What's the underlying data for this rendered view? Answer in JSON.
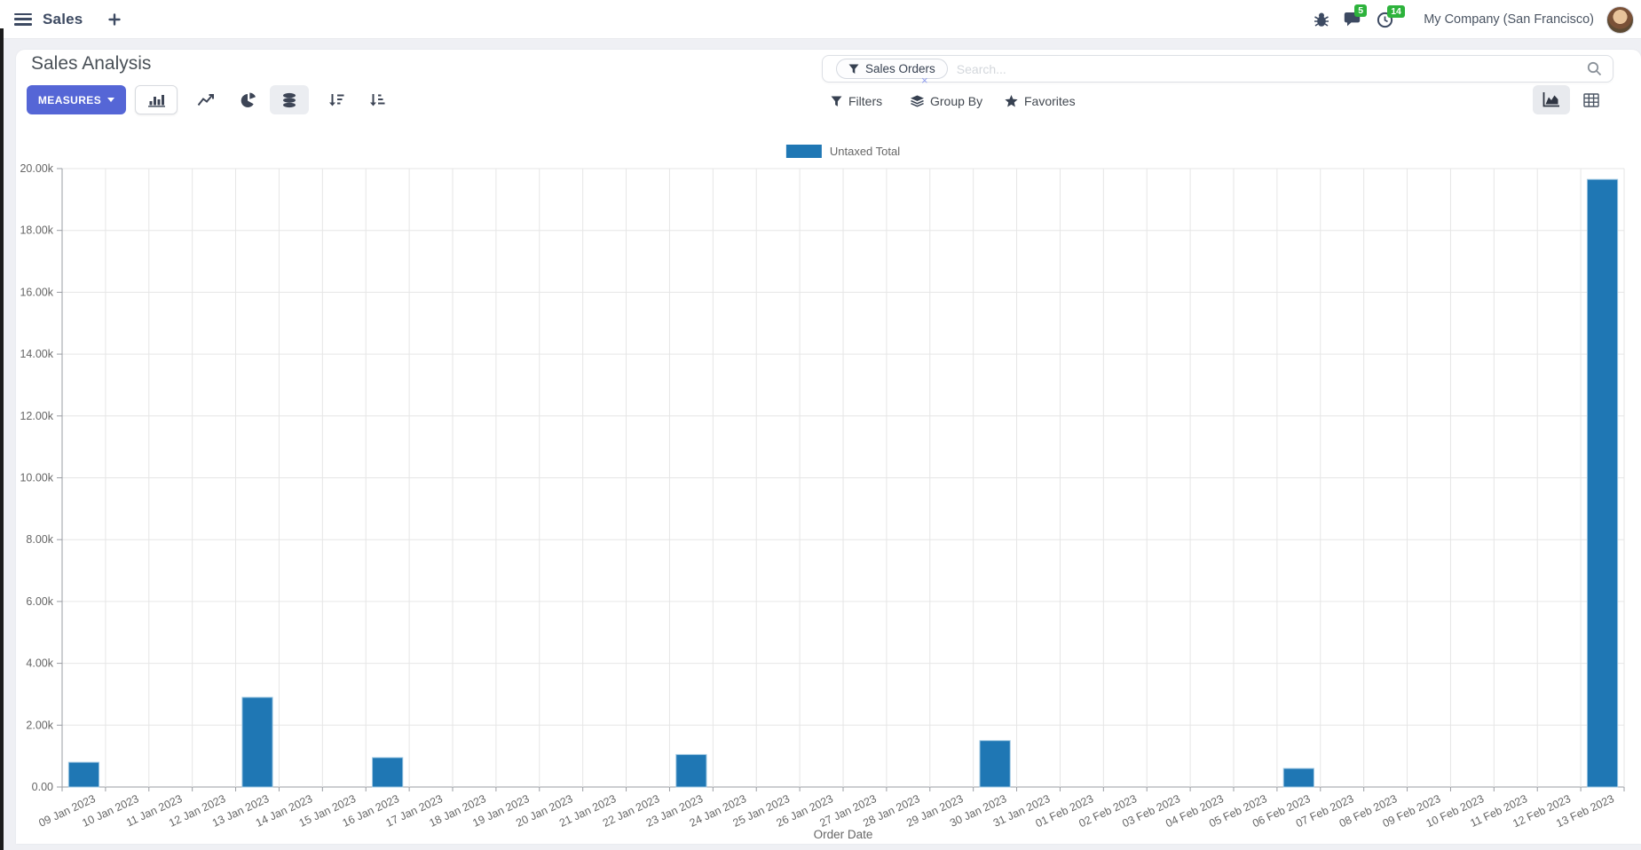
{
  "app": {
    "name": "Sales"
  },
  "topbar": {
    "company": "My Company (San Francisco)",
    "messages_count": "5",
    "activities_count": "14",
    "badge_color": "#2db33c"
  },
  "control_panel": {
    "title": "Sales Analysis",
    "measures_label": "MEASURES",
    "search": {
      "facet": "Sales Orders",
      "placeholder": "Search...",
      "remove": "×"
    },
    "filters_label": "Filters",
    "group_by_label": "Group By",
    "favorites_label": "Favorites"
  },
  "chart_data": {
    "type": "bar",
    "legend": [
      "Untaxed Total"
    ],
    "legend_position": "top-center",
    "grid": true,
    "bar_color": "#1f77b4",
    "xlabel": "Order Date",
    "ylim": [
      0,
      20000
    ],
    "yticks": {
      "values": [
        0,
        2000,
        4000,
        6000,
        8000,
        10000,
        12000,
        14000,
        16000,
        18000,
        20000
      ],
      "labels": [
        "0.00",
        "2.00k",
        "4.00k",
        "6.00k",
        "8.00k",
        "10.00k",
        "12.00k",
        "14.00k",
        "16.00k",
        "18.00k",
        "20.00k"
      ]
    },
    "categories": [
      "09 Jan 2023",
      "10 Jan 2023",
      "11 Jan 2023",
      "12 Jan 2023",
      "13 Jan 2023",
      "14 Jan 2023",
      "15 Jan 2023",
      "16 Jan 2023",
      "17 Jan 2023",
      "18 Jan 2023",
      "19 Jan 2023",
      "20 Jan 2023",
      "21 Jan 2023",
      "22 Jan 2023",
      "23 Jan 2023",
      "24 Jan 2023",
      "25 Jan 2023",
      "26 Jan 2023",
      "27 Jan 2023",
      "28 Jan 2023",
      "29 Jan 2023",
      "30 Jan 2023",
      "31 Jan 2023",
      "01 Feb 2023",
      "02 Feb 2023",
      "03 Feb 2023",
      "04 Feb 2023",
      "05 Feb 2023",
      "06 Feb 2023",
      "07 Feb 2023",
      "08 Feb 2023",
      "09 Feb 2023",
      "10 Feb 2023",
      "11 Feb 2023",
      "12 Feb 2023",
      "13 Feb 2023"
    ],
    "series": [
      {
        "name": "Untaxed Total",
        "values": [
          800,
          0,
          0,
          0,
          2900,
          0,
          0,
          950,
          0,
          0,
          0,
          0,
          0,
          0,
          1050,
          0,
          0,
          0,
          0,
          0,
          0,
          1500,
          0,
          0,
          0,
          0,
          0,
          0,
          600,
          0,
          0,
          0,
          0,
          0,
          0,
          19650
        ]
      }
    ]
  }
}
